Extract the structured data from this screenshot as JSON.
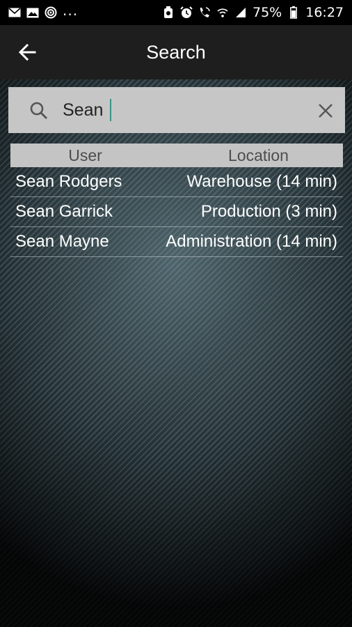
{
  "status_bar": {
    "left_icons": [
      "mail-icon",
      "image-icon",
      "target-icon"
    ],
    "overflow": "...",
    "right_icons": [
      "app-badge-icon",
      "alarm-icon",
      "wifi-call-icon",
      "wifi-icon",
      "signal-icon"
    ],
    "battery_percent": "75%",
    "time": "16:27"
  },
  "app_bar": {
    "back_icon": "arrow-left-icon",
    "title": "Search"
  },
  "search": {
    "query": "Sean",
    "search_icon": "search-icon",
    "clear_icon": "close-icon"
  },
  "results": {
    "columns": [
      "User",
      "Location"
    ],
    "rows": [
      {
        "user": "Sean Rodgers",
        "location": "Warehouse (14 min)"
      },
      {
        "user": "Sean Garrick",
        "location": "Production (3 min)"
      },
      {
        "user": "Sean Mayne",
        "location": "Administration (14 min)"
      }
    ]
  },
  "colors": {
    "status_bar_bg": "#000000",
    "app_bar_bg": "#1e1e1e",
    "search_bg": "#c6c6c6",
    "header_bg": "#c4c4c4",
    "caret": "#1aa38c"
  }
}
